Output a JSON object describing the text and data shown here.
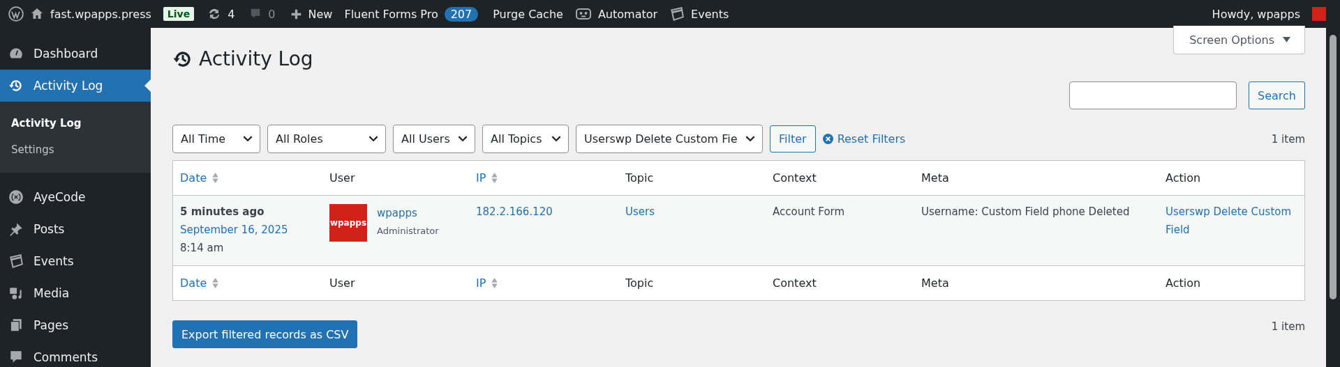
{
  "admin_bar": {
    "site": "fast.wpapps.press",
    "env_badge": "Live",
    "updates": "4",
    "comments": "0",
    "new": "New",
    "forms": "Fluent Forms Pro",
    "forms_count": "207",
    "purge": "Purge Cache",
    "automator": "Automator",
    "events": "Events",
    "howdy": "Howdy, wpapps"
  },
  "sidebar": {
    "items": [
      {
        "label": "Dashboard",
        "selected": false
      },
      {
        "label": "Activity Log",
        "selected": true,
        "children": [
          {
            "label": "Activity Log",
            "selected": true
          },
          {
            "label": "Settings",
            "selected": false
          }
        ]
      },
      {
        "label": "AyeCode",
        "selected": false
      },
      {
        "label": "Posts",
        "selected": false
      },
      {
        "label": "Events",
        "selected": false
      },
      {
        "label": "Media",
        "selected": false
      },
      {
        "label": "Pages",
        "selected": false
      },
      {
        "label": "Comments",
        "selected": false
      }
    ]
  },
  "screen_options": "Screen Options",
  "page_title": "Activity Log",
  "search_button": "Search",
  "filters": [
    {
      "value": "All Time"
    },
    {
      "value": "All Roles"
    },
    {
      "value": "All Users"
    },
    {
      "value": "All Topics"
    },
    {
      "value": "Userswp Delete Custom Fie"
    }
  ],
  "filter_button": "Filter",
  "reset_filters": "Reset Filters",
  "item_count_top": "1 item",
  "table": {
    "columns": [
      {
        "label": "Date",
        "sortable": true
      },
      {
        "label": "User",
        "sortable": false
      },
      {
        "label": "IP",
        "sortable": true
      },
      {
        "label": "Topic",
        "sortable": false
      },
      {
        "label": "Context",
        "sortable": false
      },
      {
        "label": "Meta",
        "sortable": false
      },
      {
        "label": "Action",
        "sortable": false
      }
    ],
    "rows": [
      {
        "cells": [
          {
            "kind": "date",
            "when": "5 minutes ago",
            "date": "September 16, 2025",
            "time": "8:14 am"
          },
          {
            "kind": "user",
            "avatar": "wpapps",
            "user": "wpapps",
            "role": "Administrator"
          },
          {
            "text": "182.2.166.120",
            "link": true
          },
          {
            "text": "Users",
            "link": true
          },
          {
            "text": "Account Form",
            "link": false
          },
          {
            "text": "Username: Custom Field phone Deleted",
            "link": false
          },
          {
            "text": "Userswp Delete Custom Field",
            "link": true
          }
        ]
      }
    ],
    "footer_columns": [
      {
        "label": "Date",
        "sortable": true
      },
      {
        "label": "User",
        "sortable": false
      },
      {
        "label": "IP",
        "sortable": true
      },
      {
        "label": "Topic",
        "sortable": false
      },
      {
        "label": "Context",
        "sortable": false
      },
      {
        "label": "Meta",
        "sortable": false
      },
      {
        "label": "Action",
        "sortable": false
      }
    ]
  },
  "export_button": "Export filtered records as CSV",
  "item_count_bottom": "1 item"
}
